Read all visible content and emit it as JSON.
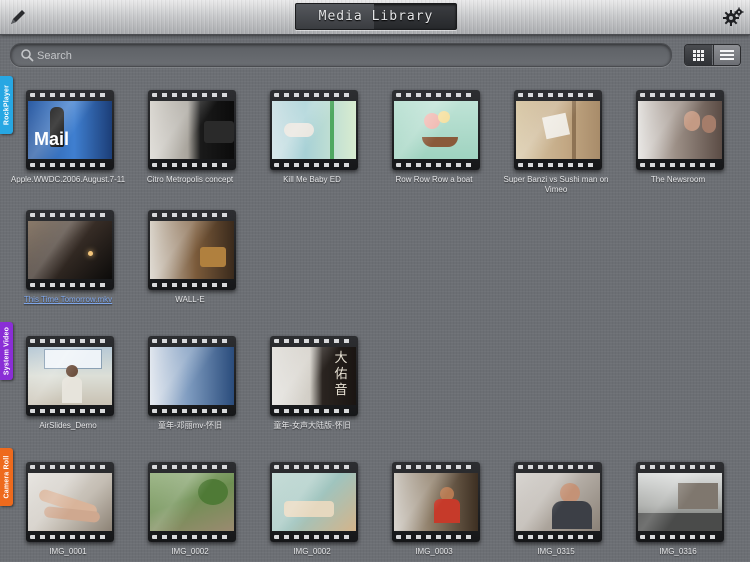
{
  "header": {
    "title": "Media Library"
  },
  "search": {
    "placeholder": "Search"
  },
  "sections": [
    {
      "label": "RockPlayer",
      "color": "#27a7e3",
      "items": [
        {
          "title": "Apple.WWDC.2006.August.7-11",
          "scene": "keynote"
        },
        {
          "title": "Citro Metropolis concept",
          "scene": "car"
        },
        {
          "title": "Kill Me Baby ED",
          "scene": "anime"
        },
        {
          "title": "Row Row Row a boat",
          "scene": "flowers"
        },
        {
          "title": "Super Banzi vs Sushi man on Vimeo",
          "scene": "paper"
        },
        {
          "title": "The Newsroom",
          "scene": "people"
        },
        {
          "title": "This Time Tomorrow.mkv",
          "scene": "dark",
          "highlight": true
        },
        {
          "title": "WALL-E",
          "scene": "warm"
        }
      ]
    },
    {
      "label": "System Video",
      "color": "#8a2ed6",
      "items": [
        {
          "title": "AirSlides_Demo",
          "scene": "presenter"
        },
        {
          "title": "童年-邓丽mv-怀旧",
          "scene": "blue"
        },
        {
          "title": "童年-女声大陆版-怀旧",
          "scene": "calligraphy"
        }
      ]
    },
    {
      "label": "Camera Roll",
      "color": "#ee6a1d",
      "items": [
        {
          "title": "IMG_0001",
          "scene": "legs"
        },
        {
          "title": "IMG_0002",
          "scene": "garden"
        },
        {
          "title": "IMG_0002",
          "scene": "cloth"
        },
        {
          "title": "IMG_0003",
          "scene": "child"
        },
        {
          "title": "IMG_0315",
          "scene": "boy"
        },
        {
          "title": "IMG_0316",
          "scene": "street"
        }
      ]
    }
  ]
}
